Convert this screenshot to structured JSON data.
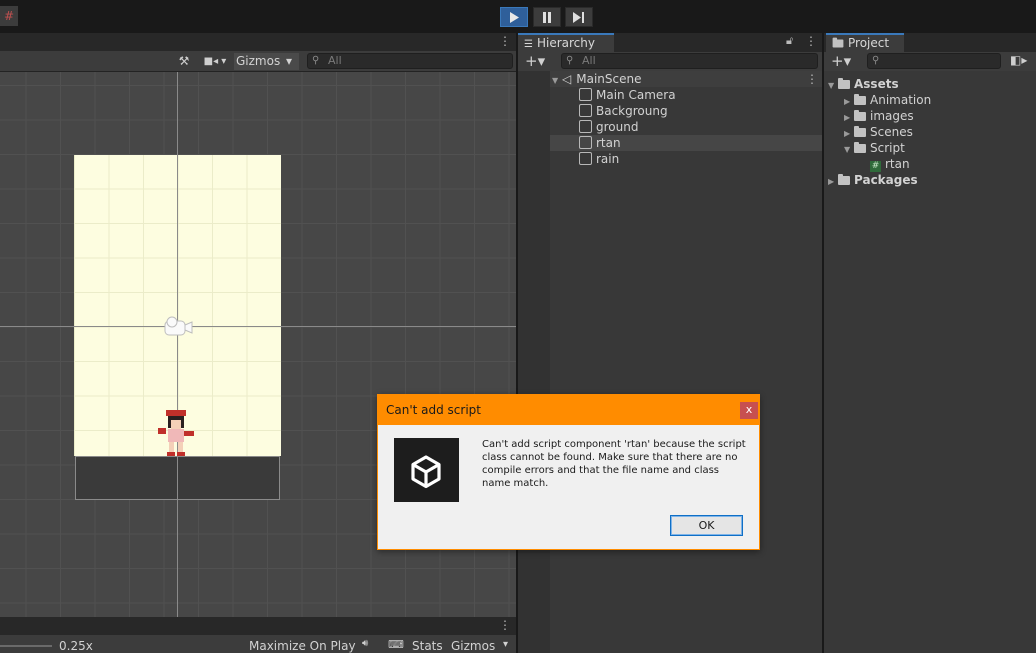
{
  "toolbar": {
    "play_icon": "play-icon",
    "pause_icon": "pause-icon",
    "step_icon": "step-icon"
  },
  "scene_toolbar": {
    "gizmos": "Gizmos",
    "search_placeholder": "All"
  },
  "hierarchy": {
    "tab": "Hierarchy",
    "search_placeholder": "All",
    "scene": "MainScene",
    "items": [
      "Main Camera",
      "Backgroung",
      "ground",
      "rtan",
      "rain"
    ]
  },
  "project": {
    "tab": "Project",
    "tree": {
      "assets": "Assets",
      "animation": "Animation",
      "images": "images",
      "scenes": "Scenes",
      "script": "Script",
      "script_file": "rtan",
      "packages": "Packages"
    }
  },
  "game_bar": {
    "scale": "0.25x",
    "maximize": "Maximize On Play",
    "stats": "Stats",
    "gizmos": "Gizmos"
  },
  "dialog": {
    "title": "Can't add script",
    "close": "x",
    "message": "Can't add script component 'rtan' because the script class cannot be found. Make sure that there are no compile errors and that the file name and class name match.",
    "ok": "OK"
  },
  "colors": {
    "dialog_accent": "#ff8c00",
    "play_active": "#2f5f9a"
  }
}
